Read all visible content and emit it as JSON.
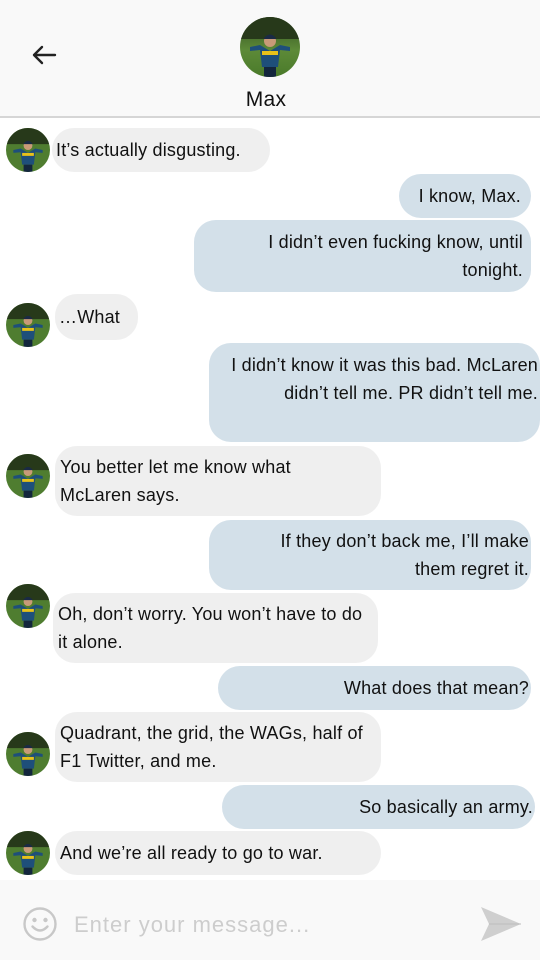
{
  "header": {
    "contact_name": "Max",
    "back_icon": "arrow-left-icon",
    "avatar_icon": "contact-avatar"
  },
  "messages": [
    {
      "side": "in",
      "text": "It’s actually disgusting."
    },
    {
      "side": "out",
      "text": "I know, Max."
    },
    {
      "side": "out",
      "text": "I didn’t even fucking know, until tonight."
    },
    {
      "side": "in",
      "text": "…What"
    },
    {
      "side": "out",
      "text": "I didn’t know it was this bad. McLaren didn’t tell me. PR didn’t tell me."
    },
    {
      "side": "in",
      "text": "You better let me know what McLaren says."
    },
    {
      "side": "out",
      "text": "If they don’t back me, I’ll make them regret it."
    },
    {
      "side": "in",
      "text": "Oh, don’t worry. You won’t have to do it alone."
    },
    {
      "side": "out",
      "text": "What does that mean?"
    },
    {
      "side": "in",
      "text": "Quadrant, the grid, the WAGs, half of F1 Twitter, and me."
    },
    {
      "side": "out",
      "text": "So basically an army."
    },
    {
      "side": "in",
      "text": "And we’re all ready to go to war."
    }
  ],
  "composer": {
    "placeholder": "Enter your message...",
    "value": "",
    "emoji_icon": "smiley-icon",
    "send_icon": "send-icon"
  },
  "colors": {
    "incoming_bubble": "#efefef",
    "outgoing_bubble": "#d3e0e9",
    "header_bg": "#f9f9f9"
  }
}
